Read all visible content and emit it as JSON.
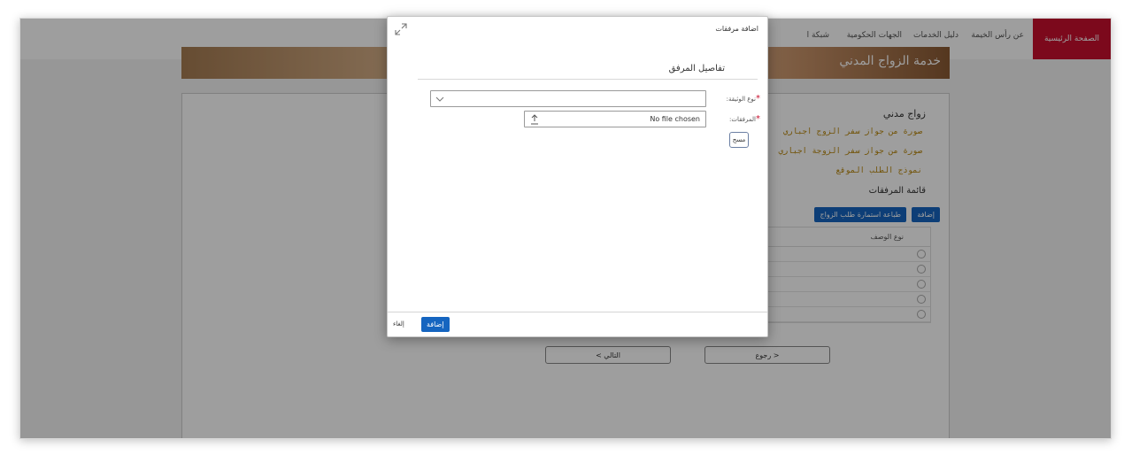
{
  "nav": {
    "home": "الصفحة الرئيسية",
    "items": [
      "عن رأس الخيمة",
      "دليل الخدمات",
      "الجهات الحكومية",
      "شبكة ا"
    ]
  },
  "banner": {
    "title": "خدمة الزواج المدني"
  },
  "content": {
    "heading": "زواج مدني",
    "requirements": [
      "صورة من جواز سفر الزوج اجباري",
      "صورة من جواز سفر الزوجة اجباري",
      "نموذج الطلب الموقع"
    ],
    "list_title": "قائمة المرفقات",
    "add_label": "إضافة",
    "print_label": "طباعة استمارة طلب الزواج",
    "table_header": "نوع الوصف",
    "row_count": 5,
    "back_label": "< رجوع",
    "next_label": "التالي >"
  },
  "dialog": {
    "title": "اضافة مرفقات",
    "section_title": "تفاصيل المرفق",
    "doc_type_label": "نوع الوثيقة:",
    "attachments_label": "المرفقات:",
    "file_text": "No file chosen",
    "clear_label": "مسح",
    "add_label": "إضافة",
    "cancel_label": "إلغاء"
  },
  "colors": {
    "accent_red": "#c8102e",
    "button_blue": "#1565c0"
  },
  "icons": [
    "expand-icon",
    "chevron-down-icon",
    "upload-icon"
  ]
}
